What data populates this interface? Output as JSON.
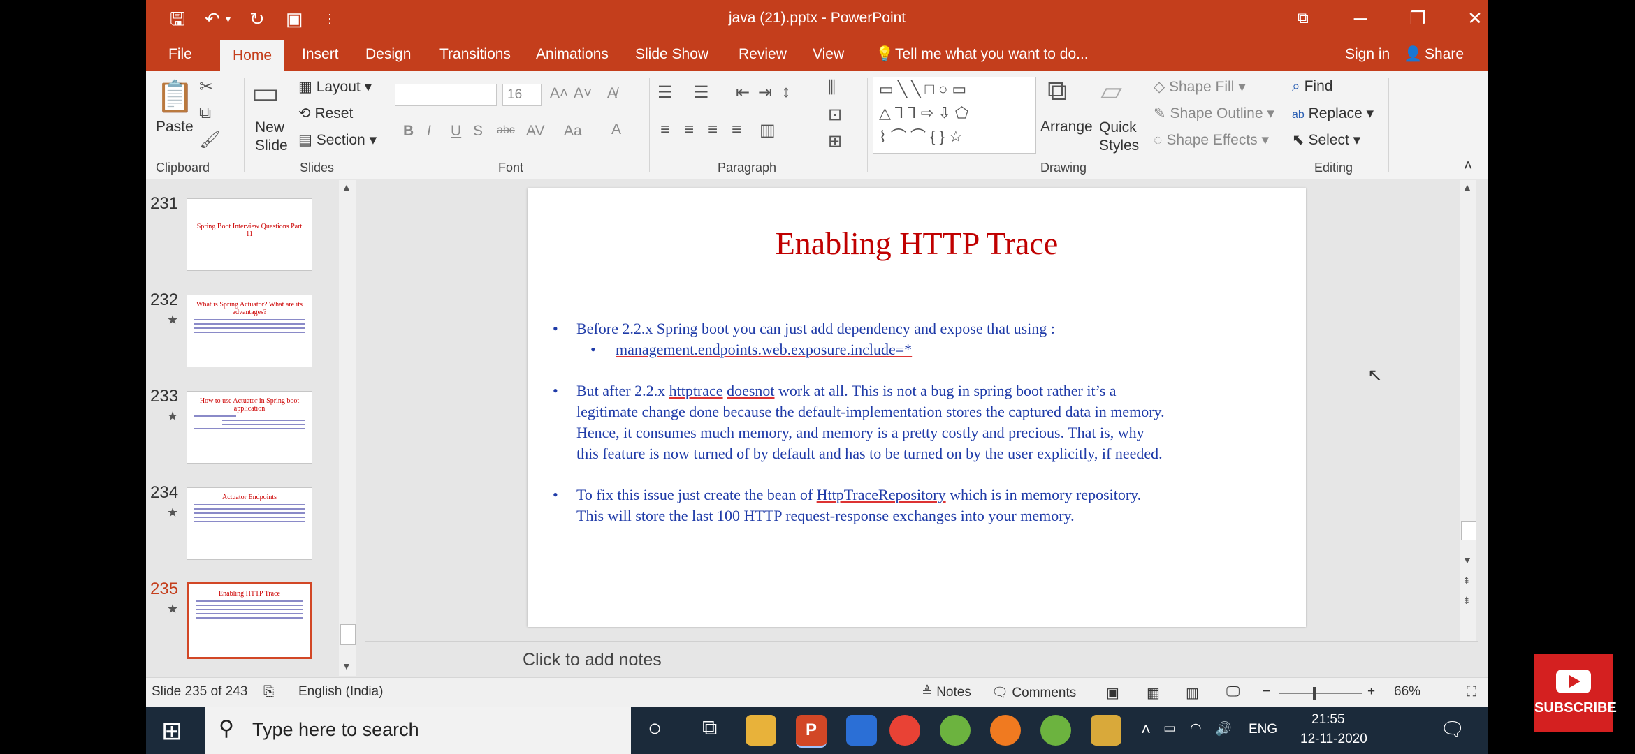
{
  "window": {
    "title": "java (21).pptx  -  PowerPoint",
    "controls": [
      "⧉",
      "─",
      "❐",
      "✕"
    ]
  },
  "qat": [
    "🖫",
    "↶",
    "▾",
    "↻",
    "▣",
    "⋮"
  ],
  "menu": {
    "tabs": [
      "File",
      "Home",
      "Insert",
      "Design",
      "Transitions",
      "Animations",
      "Slide Show",
      "Review",
      "View"
    ],
    "tell_me": "Tell me what you want to do...",
    "sign_in": "Sign in",
    "share": "Share"
  },
  "ribbon": {
    "clipboard": {
      "paste": "Paste",
      "label": "Clipboard"
    },
    "slides": {
      "new_slide": "New Slide",
      "layout": "Layout",
      "reset": "Reset",
      "section": "Section",
      "label": "Slides"
    },
    "font": {
      "size": "16",
      "label": "Font",
      "buttons": [
        "B",
        "I",
        "U",
        "S",
        "abc",
        "AV",
        "Aa",
        "A"
      ]
    },
    "paragraph": {
      "label": "Paragraph"
    },
    "drawing": {
      "arrange": "Arrange",
      "quick_styles": "Quick Styles",
      "shape_fill": "Shape Fill",
      "shape_outline": "Shape Outline",
      "shape_effects": "Shape Effects",
      "label": "Drawing"
    },
    "editing": {
      "find": "Find",
      "replace": "Replace",
      "select": "Select",
      "label": "Editing"
    }
  },
  "thumbnails": [
    {
      "number": "231",
      "title": "Spring Boot Interview Questions Part 11",
      "star": ""
    },
    {
      "number": "232",
      "title": "What is Spring Actuator? What are its advantages?",
      "star": "★"
    },
    {
      "number": "233",
      "title": "How to use Actuator in Spring boot application",
      "star": "★"
    },
    {
      "number": "234",
      "title": "Actuator Endpoints",
      "star": "★"
    },
    {
      "number": "235",
      "title": "Enabling HTTP Trace",
      "star": "★"
    }
  ],
  "slide": {
    "title": "Enabling HTTP Trace",
    "b1": "Before 2.2.x Spring boot you can just add dependency and expose that using :",
    "b1_sub": "management.endpoints.web.exposure.include=*",
    "b2_l1a": "But after 2.2.x ",
    "b2_l1b": "httptrace",
    "b2_l1c": " ",
    "b2_l1d": "doesnot",
    "b2_l1e": " work at all. This is not a bug in spring boot rather it’s a",
    "b2_l2": "legitimate change done because the default-implementation stores the captured data in memory.",
    "b2_l3": "Hence, it consumes much memory,  and memory is a pretty costly and precious. That is, why",
    "b2_l4": "this feature is now turned of by default and has to be turned on by the user explicitly, if needed.",
    "b3_l1a": "To fix this issue just create the bean of ",
    "b3_l1b": "HttpTraceRepository",
    "b3_l1c": "  which is in memory repository.",
    "b3_l2": "This will store the last 100 HTTP request-response exchanges into your memory."
  },
  "notes_placeholder": "Click to add notes",
  "status": {
    "slide_count": "Slide 235 of 243",
    "language": "English (India)",
    "notes": "Notes",
    "comments": "Comments",
    "zoom": "66%"
  },
  "taskbar": {
    "search_placeholder": "Type here to search",
    "lang": "ENG",
    "time": "21:55",
    "date": "12-11-2020"
  },
  "overlay": {
    "subscribe": "SUBSCRIBE"
  },
  "colors": {
    "accent": "#c43e1c",
    "slide_title": "#c00000",
    "slide_text": "#1f3ba8"
  }
}
